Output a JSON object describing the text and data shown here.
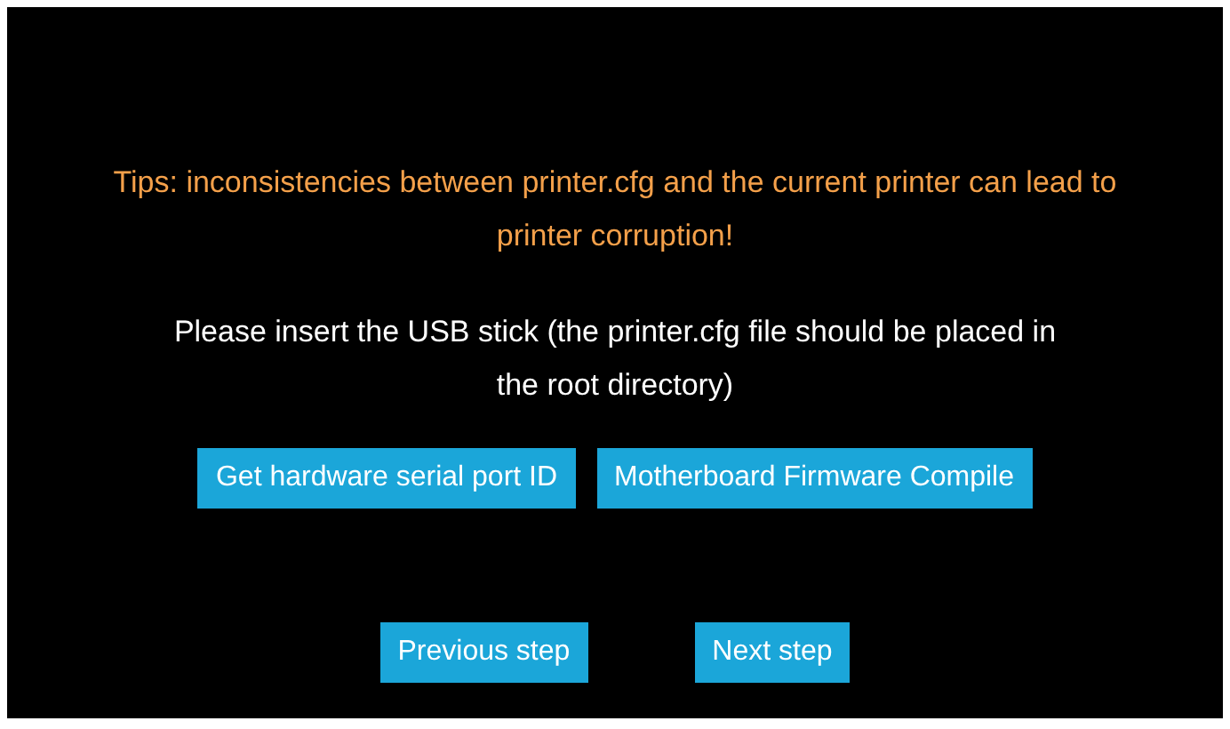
{
  "tip": "Tips: inconsistencies between printer.cfg and the current printer can lead to printer corruption!",
  "instruction": "Please insert the USB stick (the printer.cfg file should be placed in the root directory)",
  "actions": [
    "Get hardware serial port ID",
    "Motherboard Firmware Compile"
  ],
  "navigation": [
    "Previous step",
    "Next step"
  ]
}
